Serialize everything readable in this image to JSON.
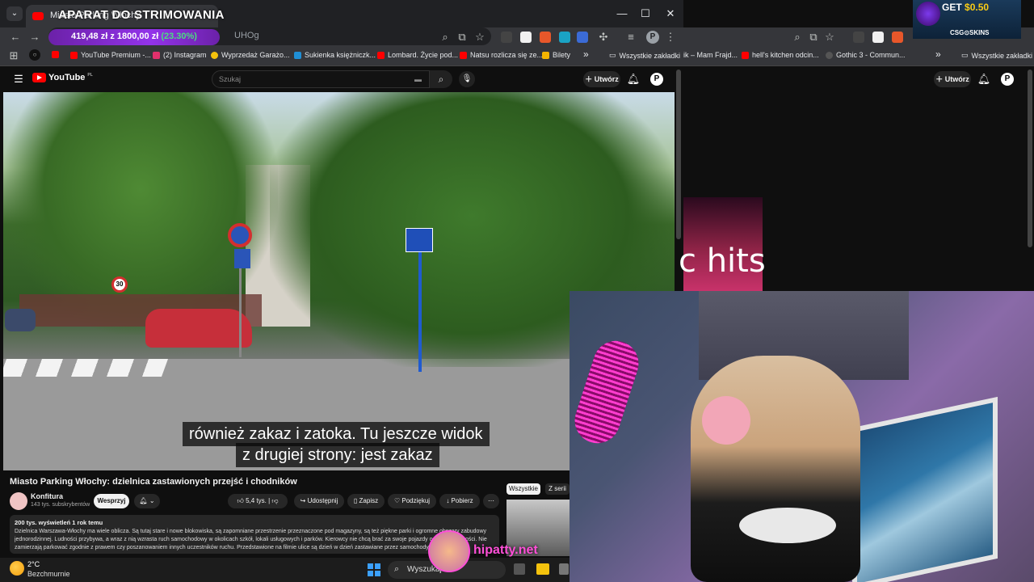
{
  "browser": {
    "tab_title": "Miasto Parking Włochy",
    "overlay_title": "APARAT DO STRIMOWANIA",
    "url_fragment": "UHOg",
    "price_overlay": {
      "value": "419,48 zł",
      "from": "z 1800,00 zł",
      "pct": "(23.30%)"
    },
    "window_controls": {
      "minimize": "—",
      "maximize": "☐",
      "close": "✕"
    },
    "bookmarks": [
      {
        "label": "YouTube Premium -...",
        "color": "#ff0000"
      },
      {
        "label": "(2) Instagram",
        "color": "#e1306c"
      },
      {
        "label": "Wyprzedaż Garażo...",
        "color": "#f4c20d"
      },
      {
        "label": "Sukienka księżniczk...",
        "color": "#1f8fd6"
      },
      {
        "label": "Lombard. Życie pod...",
        "color": "#ff0000"
      },
      {
        "label": "Natsu rozlicza się ze...",
        "color": "#ff0000"
      },
      {
        "label": "Bilety",
        "color": "#f4b400"
      }
    ],
    "bookmarks_more": "»",
    "all_bookmarks": "Wszystkie zakładki"
  },
  "youtube": {
    "logo": "YouTube",
    "logo_region": "PL",
    "search_placeholder": "Szukaj",
    "create_label": "Utwórz",
    "avatar_letter": "P",
    "subtitle_line1": "również zakaz i zatoka. Tu jeszcze widok",
    "subtitle_line2": "z drugiej strony: jest zakaz",
    "video_title": "Miasto Parking Włochy: dzielnica zastawionych przejść i chodników",
    "channel_name": "Konfitura",
    "channel_subs": "143 tys. subskrybentów",
    "support_label": "Wesprzyj",
    "likes": "5,4 tys.",
    "share_label": "Udostępnij",
    "save_label": "Zapisz",
    "thanks_label": "Podziękuj",
    "download_label": "Pobierz",
    "chips": [
      "Wszystkie",
      "Z serii"
    ],
    "desc_meta": "200 tys. wyświetleń  1 rok temu",
    "desc_text": "Dzielnica Warszawa-Włochy ma wiele oblicza. Są tutaj stare i nowe blokowiska, są zapomniane przestrzenie przeznaczone pod magazyny, są też piękne parki i ogromne obszary zabudowy jednorodzinnej. Ludności przybywa, a wraz z nią wzrasta ruch samochodowy w okolicach szkół, lokali usługowych i parków. Kierowcy nie chcą brać za swoje pojazdy odpowiedzialności. Nie zamierzają parkować zgodnie z prawem czy poszanowaniem innych uczestników ruchu. Przedstawione na filmie ulice są dzień w dzień zastawiane przez samochody"
  },
  "right_window": {
    "bookmarks": [
      "ik – Mam Frajd...",
      "hell's kitchen odcin...",
      "Gothic 3 - Commun..."
    ],
    "bookmarks_more": "»",
    "all_bookmarks": "Wszystkie zakładki",
    "create_label": "Utwórz",
    "lofi_text": "c hits"
  },
  "promo": {
    "get": "GET",
    "amount": "$0.50",
    "brand": "CSG⊙SKINS"
  },
  "taskbar": {
    "temp": "2°C",
    "weather": "Bezchmurnie",
    "search_label": "Wyszukaj"
  },
  "watermark": "hipatty.net"
}
